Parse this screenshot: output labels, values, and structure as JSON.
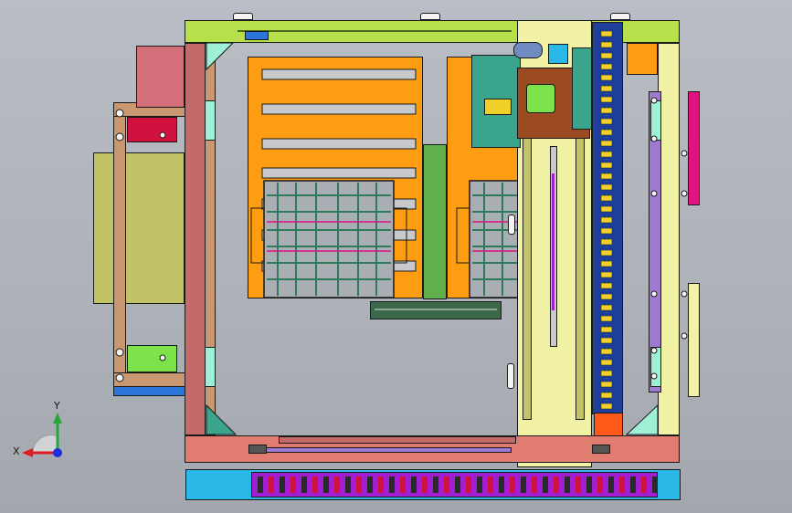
{
  "viewport": {
    "background_top": "#b9bdc4",
    "background_bottom": "#a3a7ae"
  },
  "triad": {
    "x_label": "X",
    "y_label": "Y",
    "x_color": "#e01b24",
    "y_color": "#26a53a",
    "z_color": "#1c2ee0"
  },
  "palette": {
    "top_beam": "#b8e04a",
    "left_rail": "#c46a6a",
    "frame_tan": "#c99870",
    "orange_plate": "#ff9d12",
    "gray_plate": "#9aa0a8",
    "olive_panel": "#c2c266",
    "rose_bracket": "#d4707a",
    "crimson_block": "#d1123f",
    "green_block": "#7ee24a",
    "teal_tri": "#3aa58c",
    "mint_tri": "#9ef0d6",
    "cream_frame": "#f2f2a6",
    "navy_chain": "#1e3f9c",
    "chain_blue": "#2f67d6",
    "cyan_track": "#2ab8e8",
    "purple_cable": "#a11fd1",
    "brown_carriage": "#9c4a22",
    "magenta_plate": "#e2127f",
    "lavender_rail": "#a07ad0",
    "bottom_beam": "#e07c70",
    "blue_foot": "#2b74d9",
    "dark_green": "#3a6a4a"
  }
}
